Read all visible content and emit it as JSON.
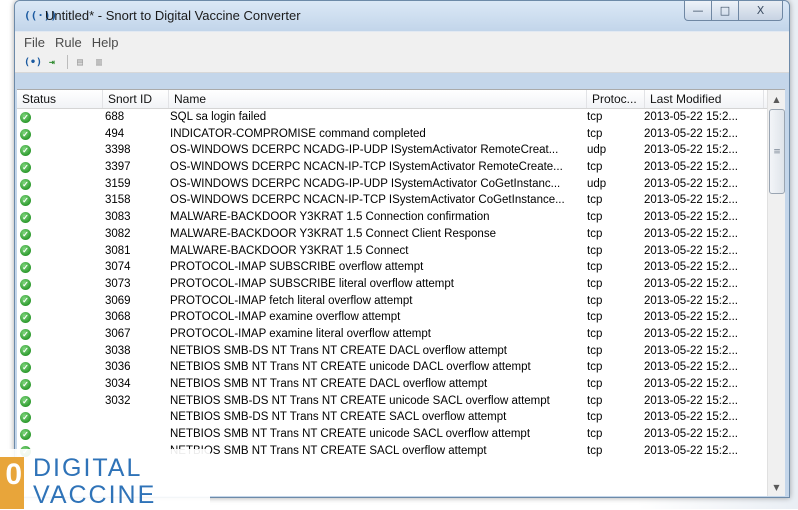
{
  "window": {
    "title": "Untitled* - Snort to Digital Vaccine Converter",
    "app_icon": "((·))"
  },
  "window_buttons": {
    "minimize": "—",
    "maximize": "□",
    "close": "X"
  },
  "menu": {
    "items": [
      {
        "label": "File"
      },
      {
        "label": "Rule"
      },
      {
        "label": "Help"
      }
    ]
  },
  "toolbar": {
    "icons": [
      "open-icon",
      "import-icon",
      "copy-icon",
      "paste-icon"
    ]
  },
  "columns": {
    "status": "Status",
    "sid": "Snort ID",
    "name": "Name",
    "protocol": "Protoc...",
    "modified": "Last Modified"
  },
  "rows": [
    {
      "sid": "688",
      "name": "SQL sa login failed",
      "protocol": "tcp",
      "modified": "2013-05-22 15:2..."
    },
    {
      "sid": "494",
      "name": "INDICATOR-COMPROMISE command completed",
      "protocol": "tcp",
      "modified": "2013-05-22 15:2..."
    },
    {
      "sid": "3398",
      "name": "OS-WINDOWS DCERPC NCADG-IP-UDP ISystemActivator RemoteCreat...",
      "protocol": "udp",
      "modified": "2013-05-22 15:2..."
    },
    {
      "sid": "3397",
      "name": "OS-WINDOWS DCERPC NCACN-IP-TCP ISystemActivator RemoteCreate...",
      "protocol": "tcp",
      "modified": "2013-05-22 15:2..."
    },
    {
      "sid": "3159",
      "name": "OS-WINDOWS DCERPC NCADG-IP-UDP ISystemActivator CoGetInstanc...",
      "protocol": "udp",
      "modified": "2013-05-22 15:2..."
    },
    {
      "sid": "3158",
      "name": "OS-WINDOWS DCERPC NCACN-IP-TCP ISystemActivator CoGetInstance...",
      "protocol": "tcp",
      "modified": "2013-05-22 15:2..."
    },
    {
      "sid": "3083",
      "name": "MALWARE-BACKDOOR Y3KRAT 1.5 Connection confirmation",
      "protocol": "tcp",
      "modified": "2013-05-22 15:2..."
    },
    {
      "sid": "3082",
      "name": "MALWARE-BACKDOOR Y3KRAT 1.5 Connect Client Response",
      "protocol": "tcp",
      "modified": "2013-05-22 15:2..."
    },
    {
      "sid": "3081",
      "name": "MALWARE-BACKDOOR Y3KRAT 1.5 Connect",
      "protocol": "tcp",
      "modified": "2013-05-22 15:2..."
    },
    {
      "sid": "3074",
      "name": "PROTOCOL-IMAP SUBSCRIBE overflow attempt",
      "protocol": "tcp",
      "modified": "2013-05-22 15:2..."
    },
    {
      "sid": "3073",
      "name": "PROTOCOL-IMAP SUBSCRIBE literal overflow attempt",
      "protocol": "tcp",
      "modified": "2013-05-22 15:2..."
    },
    {
      "sid": "3069",
      "name": "PROTOCOL-IMAP fetch literal overflow attempt",
      "protocol": "tcp",
      "modified": "2013-05-22 15:2..."
    },
    {
      "sid": "3068",
      "name": "PROTOCOL-IMAP examine overflow attempt",
      "protocol": "tcp",
      "modified": "2013-05-22 15:2..."
    },
    {
      "sid": "3067",
      "name": "PROTOCOL-IMAP examine literal overflow attempt",
      "protocol": "tcp",
      "modified": "2013-05-22 15:2..."
    },
    {
      "sid": "3038",
      "name": "NETBIOS SMB-DS NT Trans NT CREATE DACL overflow attempt",
      "protocol": "tcp",
      "modified": "2013-05-22 15:2..."
    },
    {
      "sid": "3036",
      "name": "NETBIOS SMB NT Trans NT CREATE unicode DACL overflow attempt",
      "protocol": "tcp",
      "modified": "2013-05-22 15:2..."
    },
    {
      "sid": "3034",
      "name": "NETBIOS SMB NT Trans NT CREATE DACL overflow attempt",
      "protocol": "tcp",
      "modified": "2013-05-22 15:2..."
    },
    {
      "sid": "3032",
      "name": "NETBIOS SMB-DS NT Trans NT CREATE unicode SACL overflow attempt",
      "protocol": "tcp",
      "modified": "2013-05-22 15:2..."
    },
    {
      "sid": "",
      "name": "NETBIOS SMB-DS NT Trans NT CREATE SACL overflow attempt",
      "protocol": "tcp",
      "modified": "2013-05-22 15:2..."
    },
    {
      "sid": "",
      "name": "NETBIOS SMB NT Trans NT CREATE unicode SACL overflow attempt",
      "protocol": "tcp",
      "modified": "2013-05-22 15:2..."
    },
    {
      "sid": "",
      "name": "NETBIOS SMB NT Trans NT CREATE SACL overflow attempt",
      "protocol": "tcp",
      "modified": "2013-05-22 15:2..."
    }
  ],
  "status_icon": "check-circle-icon",
  "status_color": "#2f9a2f",
  "logo": {
    "mark": "0",
    "line1": "DIGITAL",
    "line2": "VACCINE"
  }
}
